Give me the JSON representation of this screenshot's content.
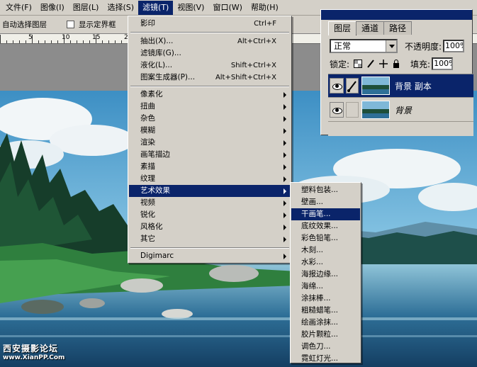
{
  "menubar": {
    "items": [
      {
        "label": "文件(F)"
      },
      {
        "label": "图像(I)"
      },
      {
        "label": "图层(L)"
      },
      {
        "label": "选择(S)"
      },
      {
        "label": "滤镜(T)"
      },
      {
        "label": "视图(V)"
      },
      {
        "label": "窗口(W)"
      },
      {
        "label": "帮助(H)"
      }
    ]
  },
  "options_bar": {
    "auto_select_label": "自动选择图层",
    "show_bounds_label": "显示定界框"
  },
  "ruler": {
    "labels": [
      "0",
      "5",
      "10",
      "15",
      "20"
    ]
  },
  "filter_menu": {
    "last_filter": {
      "label": "影印",
      "shortcut": "Ctrl+F"
    },
    "extract": {
      "label": "抽出(X)...",
      "shortcut": "Alt+Ctrl+X"
    },
    "gallery": {
      "label": "滤镜库(G)..."
    },
    "liquify": {
      "label": "液化(L)...",
      "shortcut": "Shift+Ctrl+X"
    },
    "pattern_maker": {
      "label": "图案生成器(P)...",
      "shortcut": "Alt+Shift+Ctrl+X"
    },
    "submenus": [
      {
        "label": "像素化"
      },
      {
        "label": "扭曲"
      },
      {
        "label": "杂色"
      },
      {
        "label": "模糊"
      },
      {
        "label": "渲染"
      },
      {
        "label": "画笔描边"
      },
      {
        "label": "素描"
      },
      {
        "label": "纹理"
      },
      {
        "label": "艺术效果"
      },
      {
        "label": "视频"
      },
      {
        "label": "锐化"
      },
      {
        "label": "风格化"
      },
      {
        "label": "其它"
      }
    ],
    "digimarc": {
      "label": "Digimarc"
    }
  },
  "artistic_submenu": {
    "items": [
      {
        "label": "塑料包装..."
      },
      {
        "label": "壁画..."
      },
      {
        "label": "干画笔..."
      },
      {
        "label": "底纹效果..."
      },
      {
        "label": "彩色铅笔..."
      },
      {
        "label": "木刻..."
      },
      {
        "label": "水彩..."
      },
      {
        "label": "海报边缘..."
      },
      {
        "label": "海绵..."
      },
      {
        "label": "涂抹棒..."
      },
      {
        "label": "粗糙蜡笔..."
      },
      {
        "label": "绘画涂抹..."
      },
      {
        "label": "胶片颗粒..."
      },
      {
        "label": "调色刀..."
      },
      {
        "label": "霓虹灯光..."
      }
    ]
  },
  "layers_panel": {
    "tabs": [
      {
        "label": "图层"
      },
      {
        "label": "通道"
      },
      {
        "label": "路径"
      }
    ],
    "blend_mode": "正常",
    "opacity_label": "不透明度:",
    "opacity_value": "100%",
    "lock_label": "锁定:",
    "fill_label": "填充:",
    "fill_value": "100%",
    "layers": [
      {
        "name": "背景 副本"
      },
      {
        "name": "背景"
      }
    ]
  },
  "watermark": {
    "line1": "西安摄影论坛",
    "line2": "www.XianPP.Com"
  },
  "colors": {
    "menu_highlight": "#0a246a",
    "menu_bg": "#d4d0c8"
  }
}
